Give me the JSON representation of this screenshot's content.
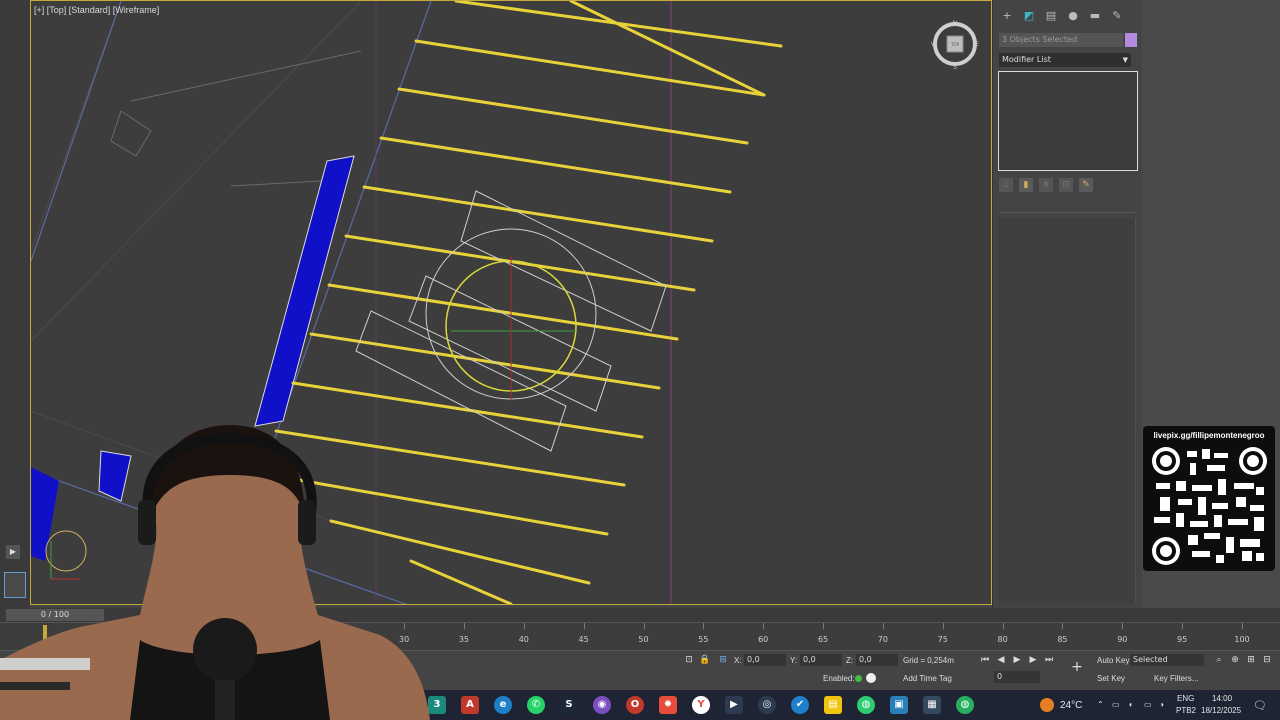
{
  "viewport": {
    "label": "[+] [Top] [Standard] [Wireframe]",
    "nav_cube": {
      "n": "N",
      "s": "S",
      "e": "E",
      "w": "W",
      "face": "TOP"
    }
  },
  "command_panel": {
    "tabs": [
      "create-icon",
      "modify-icon",
      "hierarchy-icon",
      "motion-icon",
      "display-icon",
      "utilities-icon"
    ],
    "selection_field": "3 Objects Selected",
    "swatch_color": "#b48ae0",
    "modifier_list": "Modifier List"
  },
  "qr": {
    "url": "livepix.gg/fillipemontenegroo"
  },
  "timeline": {
    "slider_label": "0 / 100",
    "ticks": [
      "30",
      "35",
      "40",
      "45",
      "50",
      "55",
      "60",
      "65",
      "70",
      "75",
      "80",
      "85",
      "90",
      "95",
      "100"
    ],
    "current_frame": 0
  },
  "status": {
    "x_label": "X:",
    "x_value": "0,0",
    "y_label": "Y:",
    "y_value": "0,0",
    "z_label": "Z:",
    "z_value": "0,0",
    "grid": "Grid = 0,254m",
    "enabled": "Enabled:",
    "add_time_tag": "Add Time Tag",
    "auto_key": "Auto Key",
    "set_key": "Set Key",
    "key_selection": "Selected",
    "key_filters": "Key Filters...",
    "frame_field": "0"
  },
  "taskbar": {
    "weather": "24°C",
    "lang_top": "ENG",
    "lang_bottom": "PTB2",
    "time": "14:00",
    "date": "18/12/2025"
  }
}
